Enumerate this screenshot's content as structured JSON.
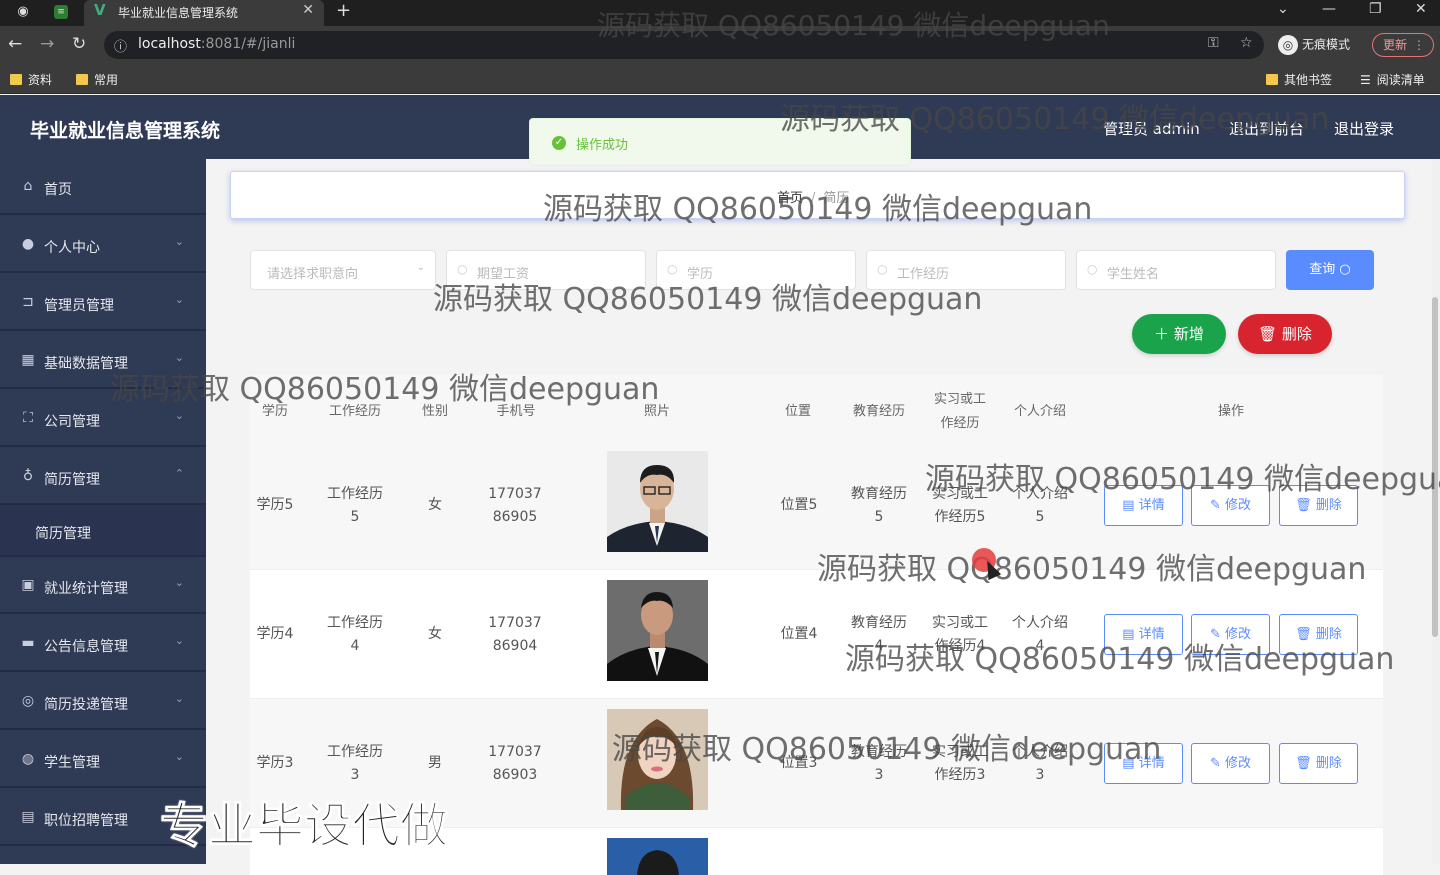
{
  "browser": {
    "tab_title": "毕业就业信息管理系统",
    "url_host": "localhost",
    "url_port": ":8081/#/jianli",
    "incognito_label": "无痕模式",
    "update_label": "更新",
    "bookmarks": [
      "资料",
      "常用",
      "其他书签",
      "阅读清单"
    ]
  },
  "header": {
    "app_title": "毕业就业信息管理系统",
    "admin_label": "管理员 admin",
    "front_label": "退出到前台",
    "logout_label": "退出登录"
  },
  "toast": {
    "message": "操作成功"
  },
  "sidebar": {
    "items": [
      {
        "label": "首页",
        "icon": "home-icon"
      },
      {
        "label": "个人中心",
        "icon": "user-icon"
      },
      {
        "label": "管理员管理",
        "icon": "admin-icon"
      },
      {
        "label": "基础数据管理",
        "icon": "data-icon"
      },
      {
        "label": "公司管理",
        "icon": "company-icon"
      },
      {
        "label": "简历管理",
        "icon": "mic-icon"
      },
      {
        "label": "就业统计管理",
        "icon": "stats-icon"
      },
      {
        "label": "公告信息管理",
        "icon": "notice-icon"
      },
      {
        "label": "简历投递管理",
        "icon": "send-icon"
      },
      {
        "label": "学生管理",
        "icon": "student-icon"
      },
      {
        "label": "职位招聘管理",
        "icon": "job-icon"
      }
    ],
    "submenu_label": "简历管理"
  },
  "breadcrumb": {
    "home": "首页",
    "current": "简历"
  },
  "filters": {
    "intent_placeholder": "请选择求职意向",
    "salary_placeholder": "期望工资",
    "education_placeholder": "学历",
    "experience_placeholder": "工作经历",
    "name_placeholder": "学生姓名",
    "query_label": "查询"
  },
  "actions": {
    "add_label": "新增",
    "delete_label": "删除"
  },
  "table": {
    "headers": {
      "education": "学历",
      "experience": "工作经历",
      "gender": "性别",
      "phone": "手机号",
      "photo": "照片",
      "location": "位置",
      "edu_history": "教育经历",
      "internship": "实习或工作经历",
      "intro": "个人介绍",
      "ops": "操作"
    },
    "row_buttons": {
      "detail": "详情",
      "edit": "修改",
      "delete": "删除"
    },
    "rows": [
      {
        "education": "学历5",
        "experience": "工作经历5",
        "gender": "女",
        "phone": "17703786905",
        "location": "位置5",
        "edu_history": "教育经历5",
        "internship": "实习或工作经历5",
        "intro": "个人介绍5"
      },
      {
        "education": "学历4",
        "experience": "工作经历4",
        "gender": "女",
        "phone": "17703786904",
        "location": "位置4",
        "edu_history": "教育经历4",
        "internship": "实习或工作经历4",
        "intro": "个人介绍4"
      },
      {
        "education": "学历3",
        "experience": "工作经历3",
        "gender": "男",
        "phone": "17703786903",
        "location": "位置3",
        "edu_history": "教育经历3",
        "internship": "实习或工作经历3",
        "intro": "个人介绍3"
      }
    ]
  },
  "watermarks": {
    "text": "源码获取 QQ86050149 微信deepguan",
    "big": "专业毕设代做"
  }
}
